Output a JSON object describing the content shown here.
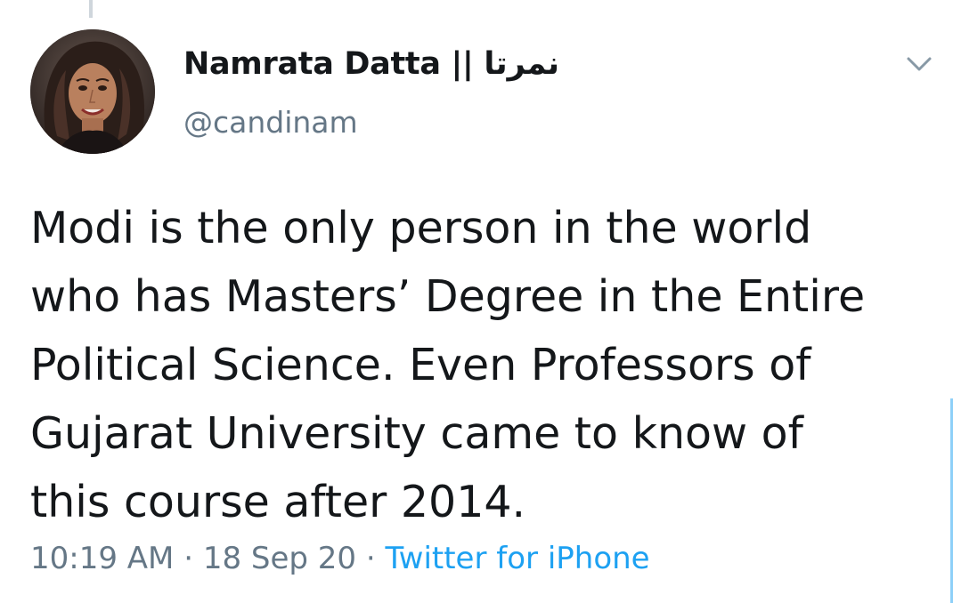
{
  "tweet": {
    "display_name": "Namrata Datta || نمرتا",
    "handle": "@candinam",
    "text_lines": [
      "Modi is the only person in the world",
      "who has Masters’ Degree in the Entire",
      "Political Science. Even Professors of",
      "Gujarat University came to know of",
      "this course after 2014."
    ],
    "time": "10:19 AM",
    "date": "18 Sep 20",
    "separator": "·",
    "source": "Twitter for iPhone"
  },
  "icons": {
    "avatar": "profile-photo",
    "menu": "chevron-down-icon"
  },
  "colors": {
    "text": "#14171a",
    "secondary": "#657786",
    "link": "#1da1f2"
  }
}
